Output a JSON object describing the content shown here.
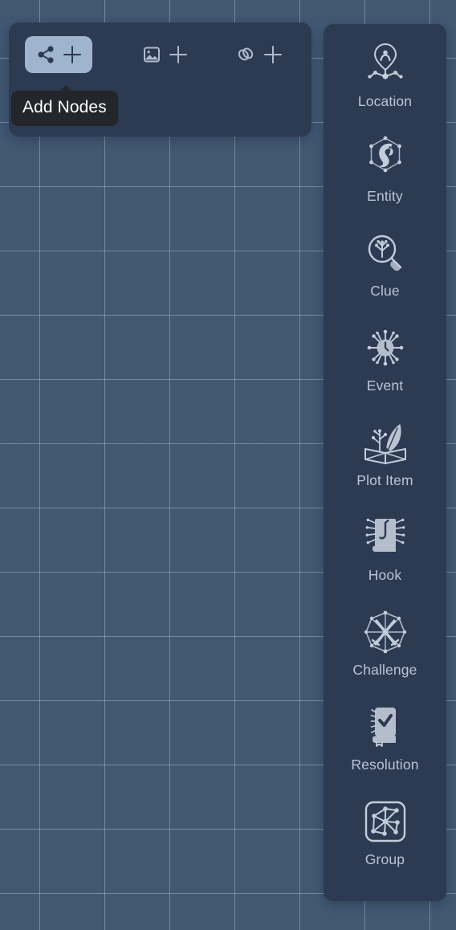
{
  "app": {
    "canvas_name": "node-graph-canvas",
    "background_color": "#415772",
    "panel_color": "#2c3a52",
    "grid_line_color": "#bed0e4",
    "label_color": "#b9c6d6",
    "active_button_color": "#9fb4cd"
  },
  "toolbar": {
    "name": "add-toolbar",
    "groups": [
      {
        "id": "add-nodes",
        "icon": "share-nodes-icon",
        "action_icon": "plus-icon",
        "active": true
      },
      {
        "id": "add-image",
        "icon": "image-icon",
        "action_icon": "plus-icon",
        "active": false
      },
      {
        "id": "add-link",
        "icon": "link-chain-icon",
        "action_icon": "plus-icon",
        "active": false
      }
    ]
  },
  "tooltip": {
    "text": "Add Nodes",
    "background": "#24262b",
    "color": "#ffffff"
  },
  "palette": {
    "name": "node-type-palette",
    "items": [
      {
        "label": "Location",
        "icon": "location-pin-network-icon"
      },
      {
        "label": "Entity",
        "icon": "creature-network-icon"
      },
      {
        "label": "Clue",
        "icon": "magnifier-tree-icon"
      },
      {
        "label": "Event",
        "icon": "clock-burst-icon"
      },
      {
        "label": "Plot Item",
        "icon": "book-quill-icon"
      },
      {
        "label": "Hook",
        "icon": "book-hook-icon"
      },
      {
        "label": "Challenge",
        "icon": "crossed-swords-network-icon"
      },
      {
        "label": "Resolution",
        "icon": "book-check-icon"
      },
      {
        "label": "Group",
        "icon": "group-network-square-icon"
      }
    ]
  }
}
